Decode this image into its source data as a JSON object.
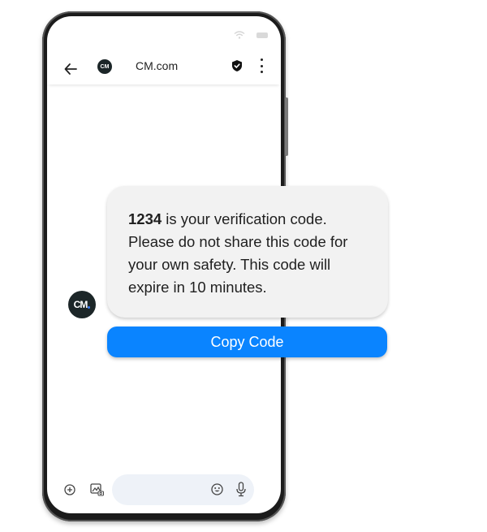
{
  "header": {
    "title": "CM.com",
    "logo_text": "CM"
  },
  "message": {
    "sender_avatar_text": "CM",
    "code": "1234",
    "body_after_code": " is your verification code. Please do not share this code for your own safety. This code will expire in 10 minutes."
  },
  "actions": {
    "copy_button_label": "Copy Code"
  },
  "composer": {
    "placeholder": ""
  },
  "icons": {
    "back": "arrow-left-icon",
    "verified": "shield-check-icon",
    "menu": "more-vertical-icon",
    "add": "plus-circle-icon",
    "gallery": "gallery-camera-icon",
    "emoji": "emoji-icon",
    "mic": "microphone-icon",
    "wifi": "wifi-icon",
    "battery": "battery-icon"
  },
  "colors": {
    "accent": "#0a84ff",
    "bubble": "#f2f2f2",
    "composer": "#eef2f8",
    "logo_bg": "#1c2628"
  }
}
